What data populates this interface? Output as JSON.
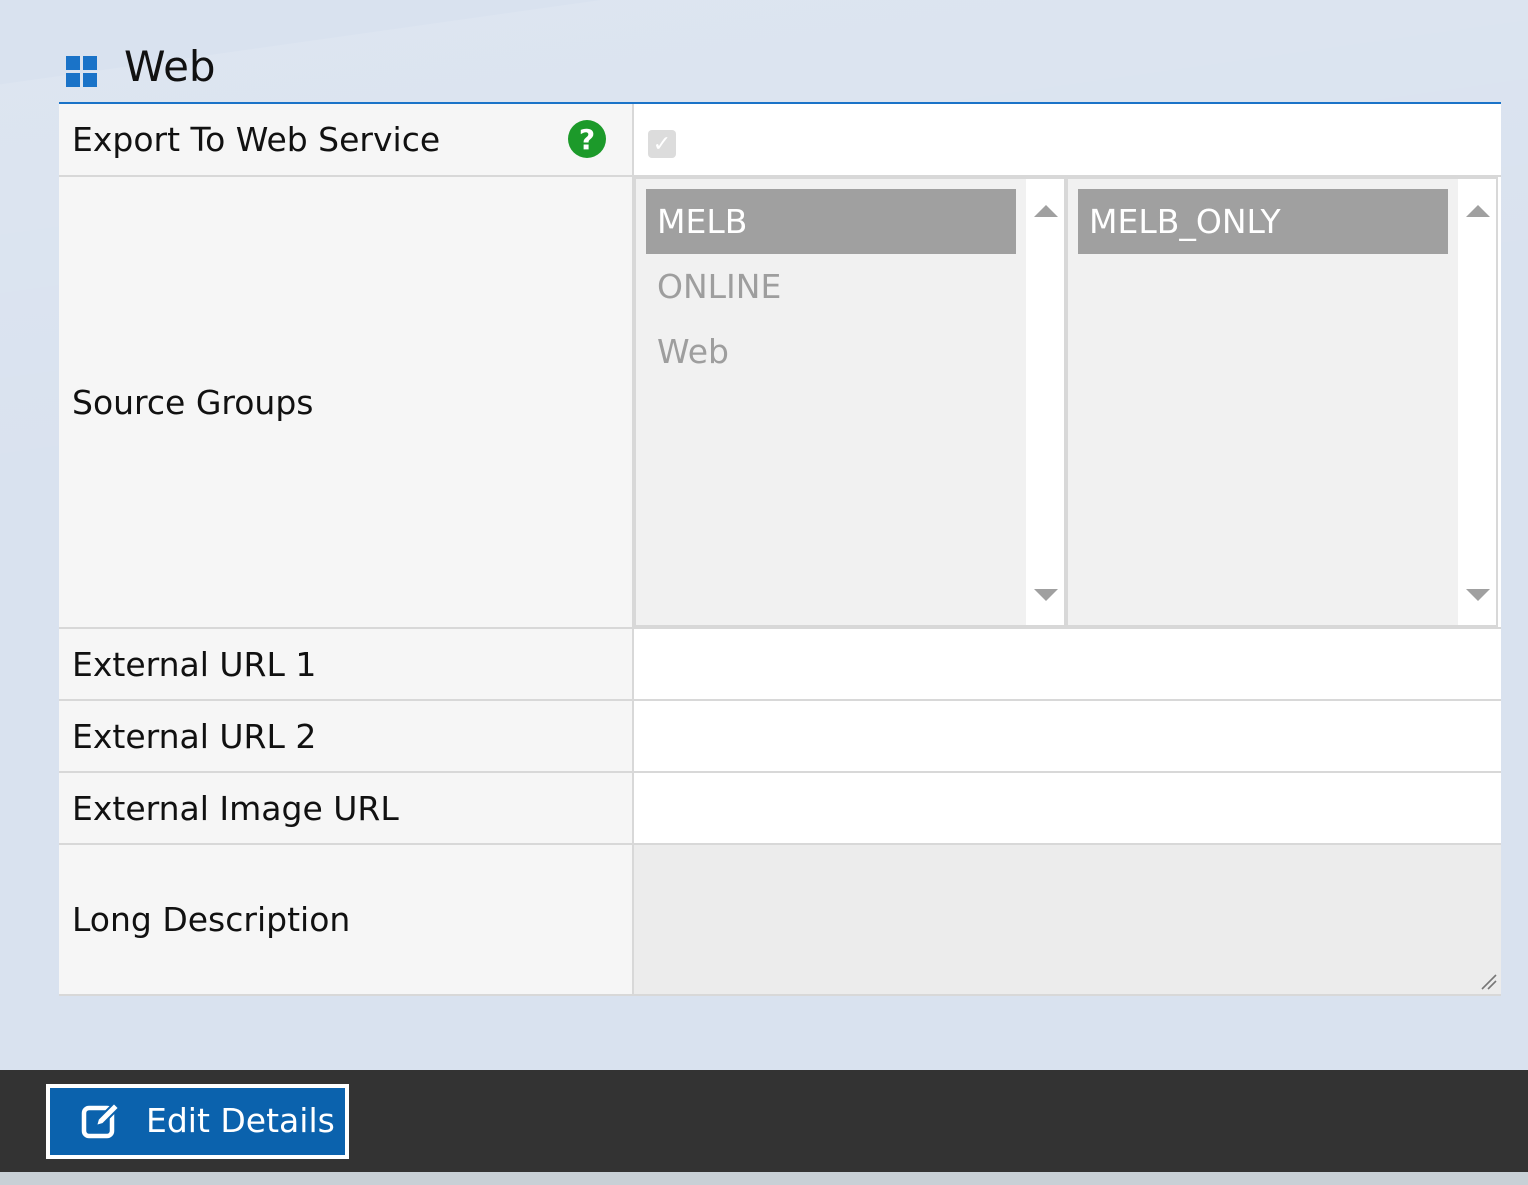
{
  "section": {
    "title": "Web",
    "icon": "windows-grid-icon",
    "accent_color": "#1a73c8"
  },
  "fields": {
    "export_to_web_service": {
      "label": "Export To Web Service",
      "help_icon": "question-icon",
      "checked": true
    },
    "source_groups": {
      "label": "Source Groups",
      "available": [
        {
          "label": "MELB",
          "selected": true
        },
        {
          "label": "ONLINE",
          "selected": false
        },
        {
          "label": "Web",
          "selected": false
        }
      ],
      "assigned": [
        {
          "label": "MELB_ONLY",
          "selected": true
        }
      ]
    },
    "external_url_1": {
      "label": "External URL 1",
      "value": ""
    },
    "external_url_2": {
      "label": "External URL 2",
      "value": ""
    },
    "external_image_url": {
      "label": "External Image URL",
      "value": ""
    },
    "long_description": {
      "label": "Long Description",
      "value": ""
    }
  },
  "footer": {
    "edit_button_label": "Edit Details",
    "edit_icon": "edit-icon",
    "button_color": "#0b62ad"
  }
}
